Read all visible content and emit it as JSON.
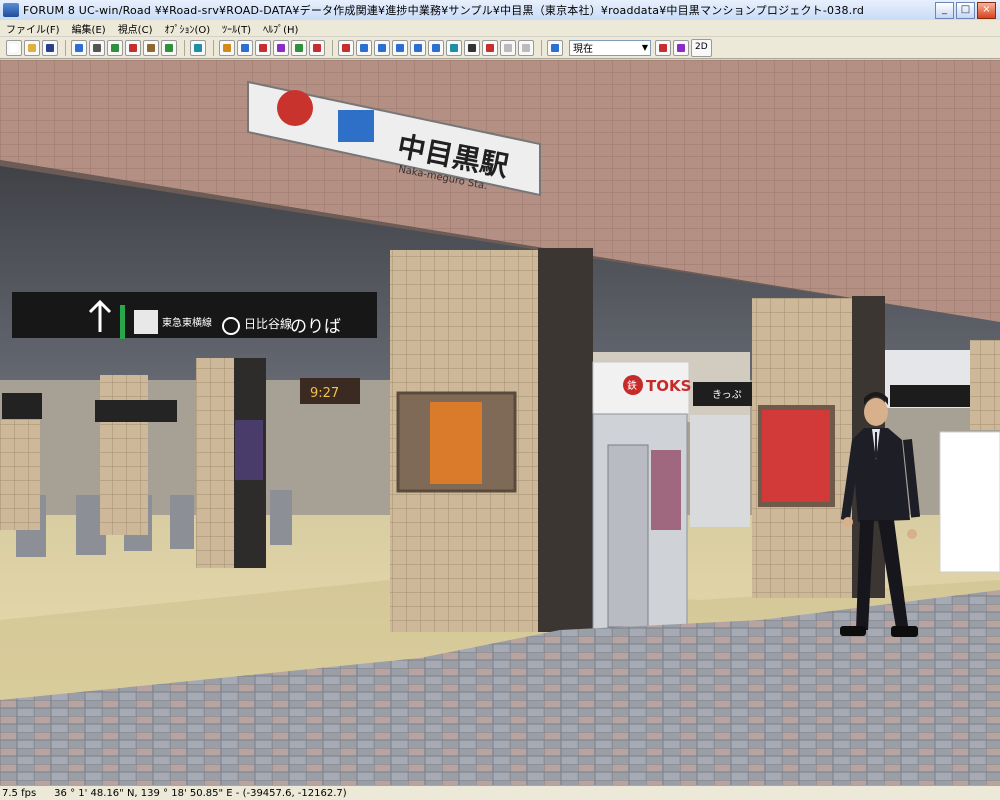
{
  "window": {
    "title": "FORUM 8    UC-win/Road    ¥¥Road-srv¥ROAD-DATA¥データ作成関連¥進捗中業務¥サンプル¥中目黒（東京本社）¥roaddata¥中目黒マンションプロジェクト-038.rd",
    "buttons": {
      "minimize": "_",
      "maximize": "□",
      "close": "×"
    }
  },
  "menu": {
    "items": [
      "ファイル(F)",
      "編集(E)",
      "視点(C)",
      "ｵﾌﾟｼｮﾝ(O)",
      "ﾂｰﾙ(T)",
      "ﾍﾙﾌﾟ(H)"
    ]
  },
  "toolbar": {
    "viewpoint_select": "現在",
    "btn_2d": "2D",
    "icon_colors": [
      "#2c6fd1",
      "#d48a1a",
      "#2f8f3a",
      "#8c2cc4",
      "#c43030",
      "#1f8fa8"
    ]
  },
  "scene": {
    "station_sign": "中目黒駅",
    "station_sign_romaji": "Naka-meguro Sta.",
    "line_sign_hibiya": "日比谷線",
    "line_sign_noriba": "のりば",
    "line_sign_tokyu": "東急東横線",
    "shop_sign": "TOKS",
    "shop_logo": "鉄",
    "sign_right": "きっぷ",
    "clock_text": "9:27"
  },
  "status": {
    "fps": "7.5 fps",
    "coordinates": "36 °   1' 48.16\" N, 139 °   18' 50.85\" E  -  (-39457.6, -12162.7)"
  }
}
